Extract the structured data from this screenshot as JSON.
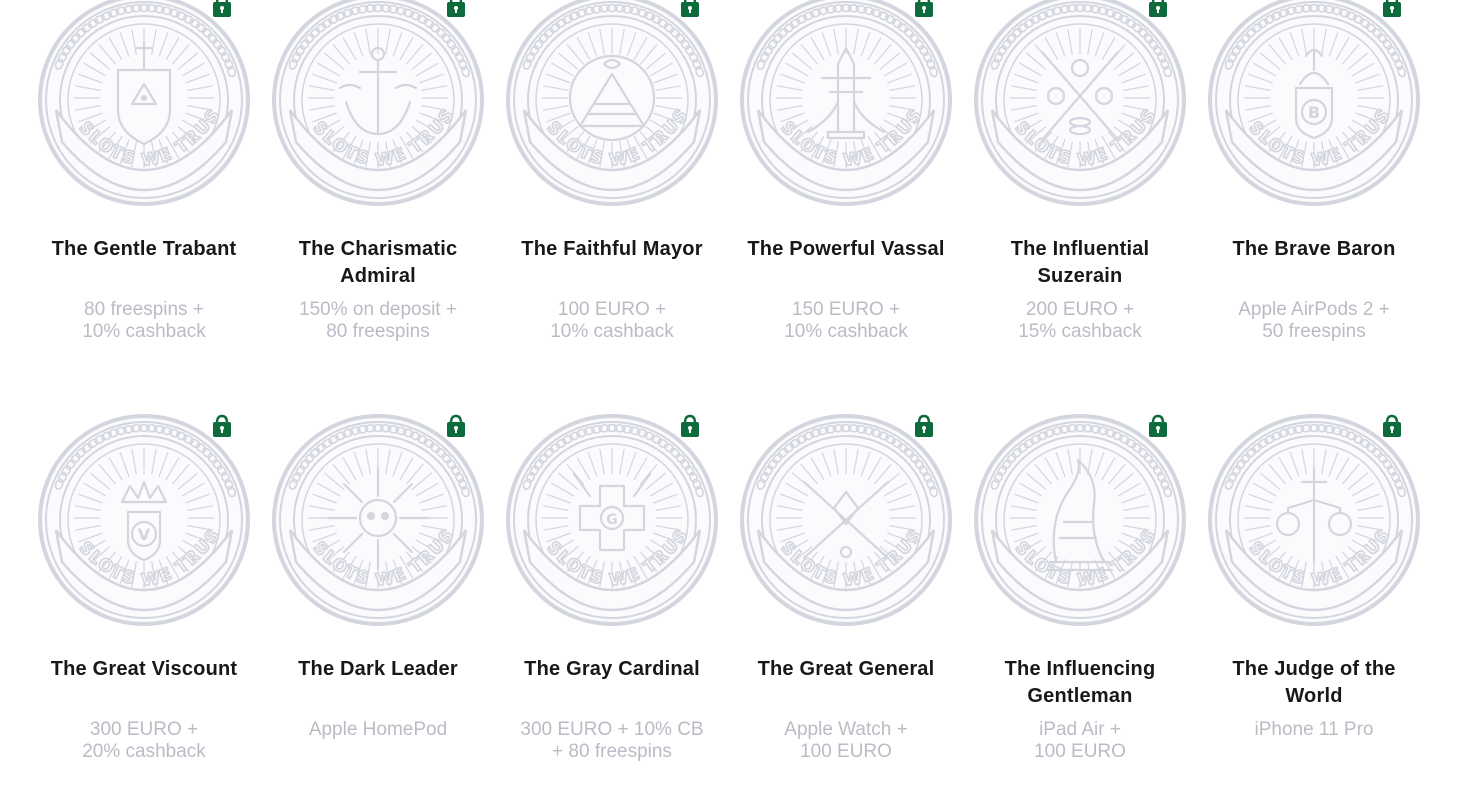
{
  "levels": [
    {
      "title_line1": "The Gentle Trabant",
      "title_line2": "",
      "reward_line1": "80 freespins +",
      "reward_line2": "10% cashback",
      "emblem": "shield-eye",
      "locked": true
    },
    {
      "title_line1": "The Charismatic",
      "title_line2": "Admiral",
      "reward_line1": "150% on deposit +",
      "reward_line2": "80 freespins",
      "emblem": "anchor",
      "locked": true
    },
    {
      "title_line1": "The Faithful Mayor",
      "title_line2": "",
      "reward_line1": "100 EURO +",
      "reward_line2": "10% cashback",
      "emblem": "pyramid-eye",
      "locked": true
    },
    {
      "title_line1": "The Powerful Vassal",
      "title_line2": "",
      "reward_line1": "150 EURO +",
      "reward_line2": "10% cashback",
      "emblem": "tower",
      "locked": true
    },
    {
      "title_line1": "The Influential",
      "title_line2": "Suzerain",
      "reward_line1": "200 EURO +",
      "reward_line2": "15% cashback",
      "emblem": "crossed-swords-coins",
      "locked": true
    },
    {
      "title_line1": "The Brave Baron",
      "title_line2": "",
      "reward_line1": "Apple AirPods 2 +",
      "reward_line2": "50 freespins",
      "emblem": "crest-b",
      "locked": true
    },
    {
      "title_line1": "The Great Viscount",
      "title_line2": "",
      "reward_line1": "300 EURO +",
      "reward_line2": "20% cashback",
      "emblem": "crown-v",
      "locked": true
    },
    {
      "title_line1": "The Dark Leader",
      "title_line2": "",
      "reward_line1": "Apple HomePod",
      "reward_line2": "",
      "emblem": "skull-sun",
      "locked": true
    },
    {
      "title_line1": "The Gray Cardinal",
      "title_line2": "",
      "reward_line1": "300 EURO + 10% CB",
      "reward_line2": "+ 80 freespins",
      "emblem": "cross-g",
      "locked": true
    },
    {
      "title_line1": "The Great General",
      "title_line2": "",
      "reward_line1": "Apple Watch +",
      "reward_line2": "100 EURO",
      "emblem": "crossed-cannons",
      "locked": true
    },
    {
      "title_line1": "The Influencing",
      "title_line2": "Gentleman",
      "reward_line1": "iPad Air +",
      "reward_line2": "100 EURO",
      "emblem": "horn",
      "locked": true
    },
    {
      "title_line1": "The Judge of the",
      "title_line2": "World",
      "reward_line1": "iPhone 11 Pro",
      "reward_line2": "",
      "emblem": "sword-scales",
      "locked": true
    }
  ],
  "medal_motto": "IN SLOTS WE TRUST",
  "colors": {
    "medal": "#d3d5df",
    "lock": "#0d6b3c",
    "title": "#17181a",
    "reward": "#b9bcc4"
  },
  "icons": {
    "lock": "shopping-bag-lock-icon"
  }
}
